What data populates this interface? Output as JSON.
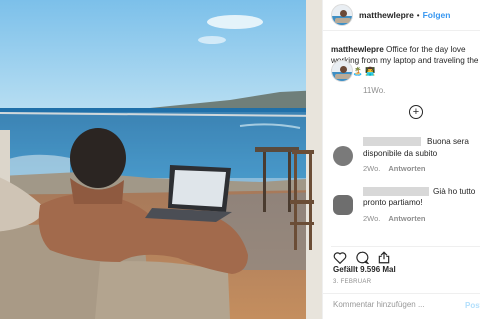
{
  "header": {
    "username": "matthewlepre",
    "separator": "•",
    "follow_label": "Folgen"
  },
  "caption": {
    "username": "matthewlepre",
    "text": " Office for the day love working from my laptop and traveling the world 🏝️ 👨‍💻",
    "time": "11Wo."
  },
  "load_more": {
    "icon": "plus-circle-icon"
  },
  "comments": [
    {
      "username_hidden": true,
      "text_line1": "Buona sera",
      "text_line2": "disponibile da subito",
      "time": "2Wo.",
      "reply_label": "Antworten",
      "avatar_color": "#7a7a7a"
    },
    {
      "username_hidden": true,
      "text_line1": "Già ho tutto",
      "text_line2": "pronto partiamo!",
      "time": "2Wo.",
      "reply_label": "Antworten",
      "avatar_color": "#6e6e6e"
    }
  ],
  "actions": {
    "icons": [
      "heart-icon",
      "comment-icon",
      "share-icon"
    ],
    "likes": "Gefällt 9.596 Mal",
    "date": "3. FEBRUAR"
  },
  "add_comment": {
    "placeholder": "Kommentar hinzufügen ...",
    "post_label": "Posten"
  },
  "colors": {
    "link_blue": "#3897f0",
    "post_disabled": "#b2dffc",
    "meta_gray": "#8e8e8e"
  }
}
